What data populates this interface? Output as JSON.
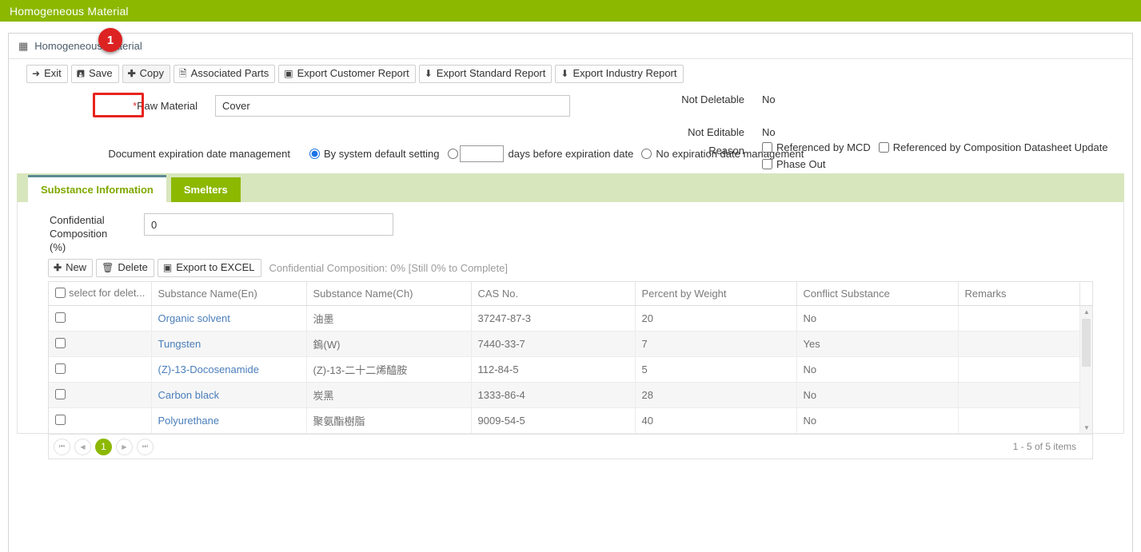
{
  "app": {
    "title": "Homogeneous Material",
    "header_color": "#8CB800"
  },
  "breadcrumb": {
    "icon": "grid-icon",
    "text": "Homogeneous Material"
  },
  "step_marker": {
    "number": "1",
    "color": "#dd2222",
    "target": "copy-button"
  },
  "toolbar": {
    "buttons": [
      {
        "label": "Exit",
        "icon": "exit-icon"
      },
      {
        "label": "Save",
        "icon": "save-icon"
      },
      {
        "label": "Copy",
        "icon": "plus-icon"
      },
      {
        "label": "Associated Parts",
        "icon": "document-icon"
      },
      {
        "label": "Export Customer Report",
        "icon": "excel-icon"
      },
      {
        "label": "Export Standard Report",
        "icon": "download-icon"
      },
      {
        "label": "Export Industry Report",
        "icon": "download-icon"
      }
    ]
  },
  "form": {
    "raw_material": {
      "label": "*Raw Material",
      "label_text": "Raw Material",
      "required_mark": "*",
      "value": "Cover"
    },
    "not_deletable": {
      "label": "Not Deletable",
      "value": "No"
    },
    "not_editable": {
      "label": "Not Editable",
      "value": "No"
    },
    "reason": {
      "label": "Reason",
      "checkboxes": [
        {
          "label": "Referenced by MCD",
          "checked": false
        },
        {
          "label": "Referenced by Composition Datasheet Update",
          "checked": false
        },
        {
          "label": "Phase Out",
          "checked": false
        }
      ]
    },
    "expiration": {
      "label": "Document expiration date management",
      "option_system_default": "By system default setting",
      "option_days_suffix": "days before expiration date",
      "days_value": "",
      "option_none": "No expiration date management",
      "selected": "By system default setting"
    }
  },
  "tabs": [
    {
      "label": "Substance Information",
      "active": true
    },
    {
      "label": "Smelters",
      "active": false
    }
  ],
  "substance_tab": {
    "confidential_composition": {
      "label": "Confidential Composition (%)",
      "label_lines": [
        "Confidential",
        "Composition",
        "(%)"
      ],
      "value": "0"
    },
    "grid_toolbar": {
      "buttons": [
        {
          "label": "New",
          "icon": "plus-icon"
        },
        {
          "label": "Delete",
          "icon": "trash-icon"
        },
        {
          "label": "Export to EXCEL",
          "icon": "excel-icon"
        }
      ],
      "note": "Confidential Composition: 0% [Still 0% to Complete]"
    },
    "grid": {
      "columns": [
        "select for delet...",
        "Substance Name(En)",
        "Substance Name(Ch)",
        "CAS No.",
        "Percent by Weight",
        "Conflict Substance",
        "Remarks"
      ],
      "rows": [
        {
          "selected": false,
          "name_en": "Organic solvent",
          "name_ch": "油墨",
          "cas": "37247-87-3",
          "percent": "20",
          "conflict": "No",
          "remarks": ""
        },
        {
          "selected": false,
          "name_en": "Tungsten",
          "name_ch": "鎢(W)",
          "cas": "7440-33-7",
          "percent": "7",
          "conflict": "Yes",
          "remarks": ""
        },
        {
          "selected": false,
          "name_en": "(Z)-13-Docosenamide",
          "name_ch": "(Z)-13-二十二烯醯胺",
          "cas": "112-84-5",
          "percent": "5",
          "conflict": "No",
          "remarks": ""
        },
        {
          "selected": false,
          "name_en": "Carbon black",
          "name_ch": "炭黑",
          "cas": "1333-86-4",
          "percent": "28",
          "conflict": "No",
          "remarks": ""
        },
        {
          "selected": false,
          "name_en": "Polyurethane",
          "name_ch": "聚氨酯樹脂",
          "cas": "9009-54-5",
          "percent": "40",
          "conflict": "No",
          "remarks": ""
        }
      ]
    },
    "pager": {
      "first_icon": "first-page-icon",
      "prev_icon": "prev-page-icon",
      "current_page": "1",
      "next_icon": "next-page-icon",
      "last_icon": "last-page-icon",
      "summary": "1 - 5 of 5 items"
    }
  }
}
